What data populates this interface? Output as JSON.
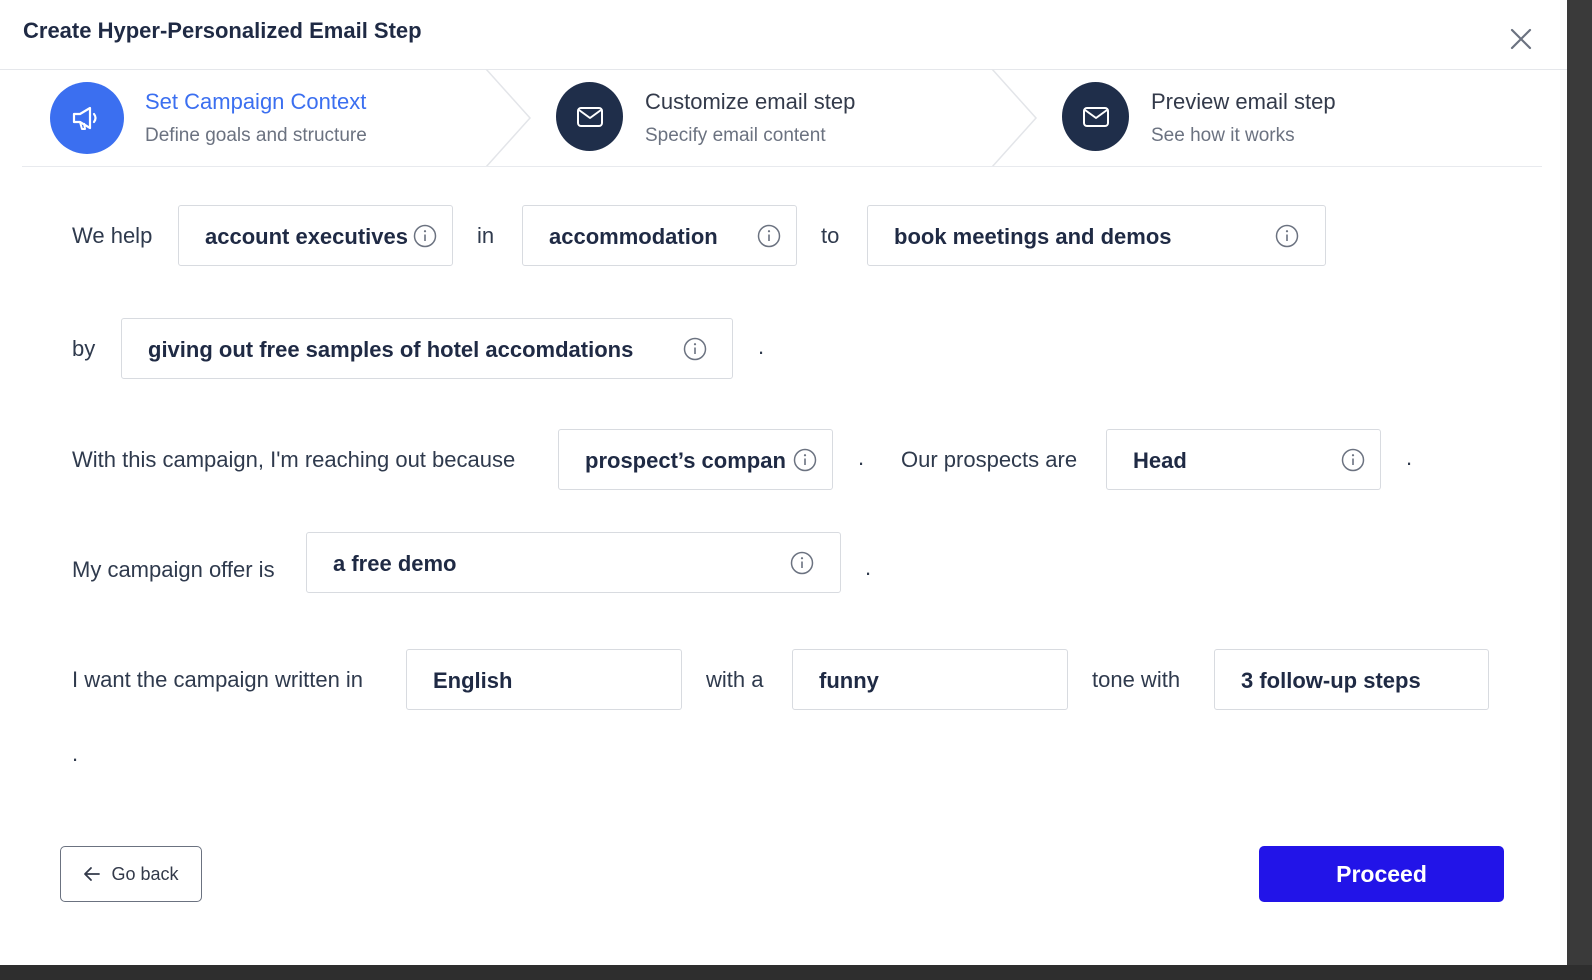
{
  "dialog": {
    "title": "Create Hyper-Personalized Email Step"
  },
  "steps": [
    {
      "title": "Set Campaign Context",
      "subtitle": "Define goals and structure",
      "icon": "megaphone-icon"
    },
    {
      "title": "Customize email step",
      "subtitle": "Specify email content",
      "icon": "envelope-icon"
    },
    {
      "title": "Preview email step",
      "subtitle": "See how it works",
      "icon": "envelope-icon"
    }
  ],
  "form": {
    "we_help_label": "We help",
    "audience": "account executives",
    "in_label": "in",
    "industry": "accommodation",
    "to_label": "to",
    "goal": "book meetings and demos",
    "by_label": "by",
    "method": "giving out free samples of hotel accomdations",
    "reason_label": "With this campaign, I'm reaching out because",
    "reason": "prospect’s compan",
    "prospects_label": "Our prospects are",
    "prospects": "Head",
    "offer_label": "My campaign offer is",
    "offer": "a free demo",
    "language_label": "I want the campaign written in",
    "language": "English",
    "with_a_label": "with a",
    "tone": "funny",
    "tone_with_label": "tone with",
    "followups": "3 follow-up steps",
    "period": "."
  },
  "footer": {
    "back_label": "Go back",
    "proceed_label": "Proceed"
  },
  "colors": {
    "active": "#3b6ff0",
    "dark_step": "#1f2e4a",
    "primary_button": "#2214e8"
  }
}
